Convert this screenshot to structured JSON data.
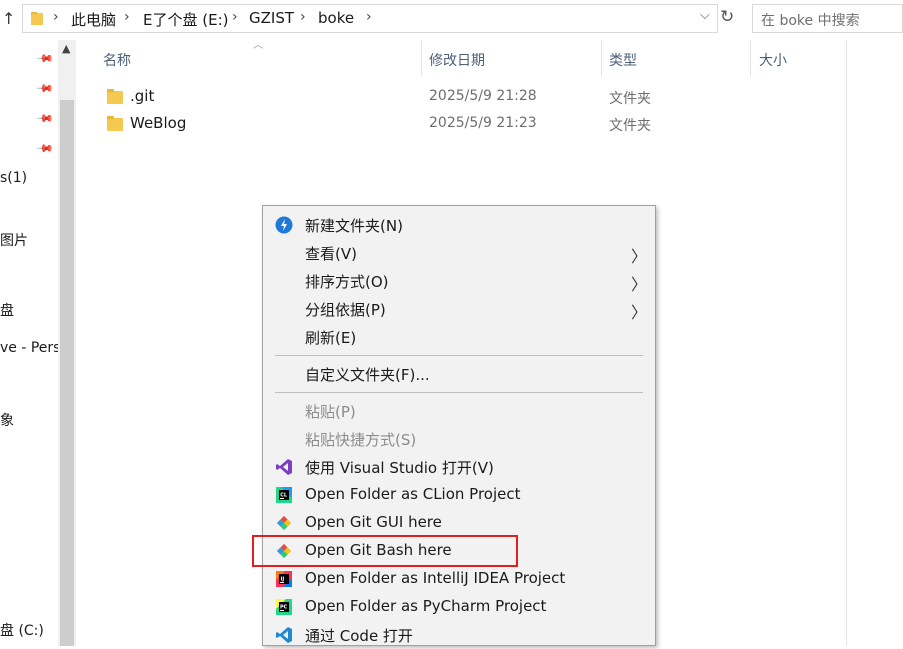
{
  "address_bar": {
    "crumbs": [
      "此电脑",
      "E了个盘 (E:)",
      "GZIST",
      "boke"
    ],
    "search_placeholder": "在 boke 中搜索"
  },
  "nav_pane": {
    "items": [
      "s(1)",
      "图片",
      "盘",
      "ve - Pers",
      "象",
      "盘 (C:)"
    ]
  },
  "columns": [
    "名称",
    "修改日期",
    "类型",
    "大小"
  ],
  "files": [
    {
      "name": ".git",
      "modified": "2025/5/9 21:28",
      "type": "文件夹"
    },
    {
      "name": "WeBlog",
      "modified": "2025/5/9 21:23",
      "type": "文件夹"
    }
  ],
  "context_menu": {
    "items": [
      {
        "label": "新建文件夹(N)",
        "icon": "new-folder-icon"
      },
      {
        "label": "查看(V)",
        "submenu": true
      },
      {
        "label": "排序方式(O)",
        "submenu": true
      },
      {
        "label": "分组依据(P)",
        "submenu": true
      },
      {
        "label": "刷新(E)"
      },
      {
        "label": "自定义文件夹(F)..."
      },
      {
        "label": "粘贴(P)",
        "disabled": true
      },
      {
        "label": "粘贴快捷方式(S)",
        "disabled": true
      },
      {
        "label": "使用 Visual Studio 打开(V)",
        "icon": "visual-studio-icon"
      },
      {
        "label": "Open Folder as CLion Project",
        "icon": "clion-icon"
      },
      {
        "label": "Open Git GUI here",
        "icon": "git-icon"
      },
      {
        "label": "Open Git Bash here",
        "icon": "git-icon",
        "highlighted": true
      },
      {
        "label": "Open Folder as IntelliJ IDEA Project",
        "icon": "intellij-icon"
      },
      {
        "label": "Open Folder as PyCharm Project",
        "icon": "pycharm-icon"
      },
      {
        "label": "通过 Code 打开",
        "icon": "vscode-icon"
      }
    ]
  },
  "colors": {
    "highlight_border": "#e02020",
    "menu_bg": "#f2f2f2",
    "folder": "#f5c94f"
  }
}
